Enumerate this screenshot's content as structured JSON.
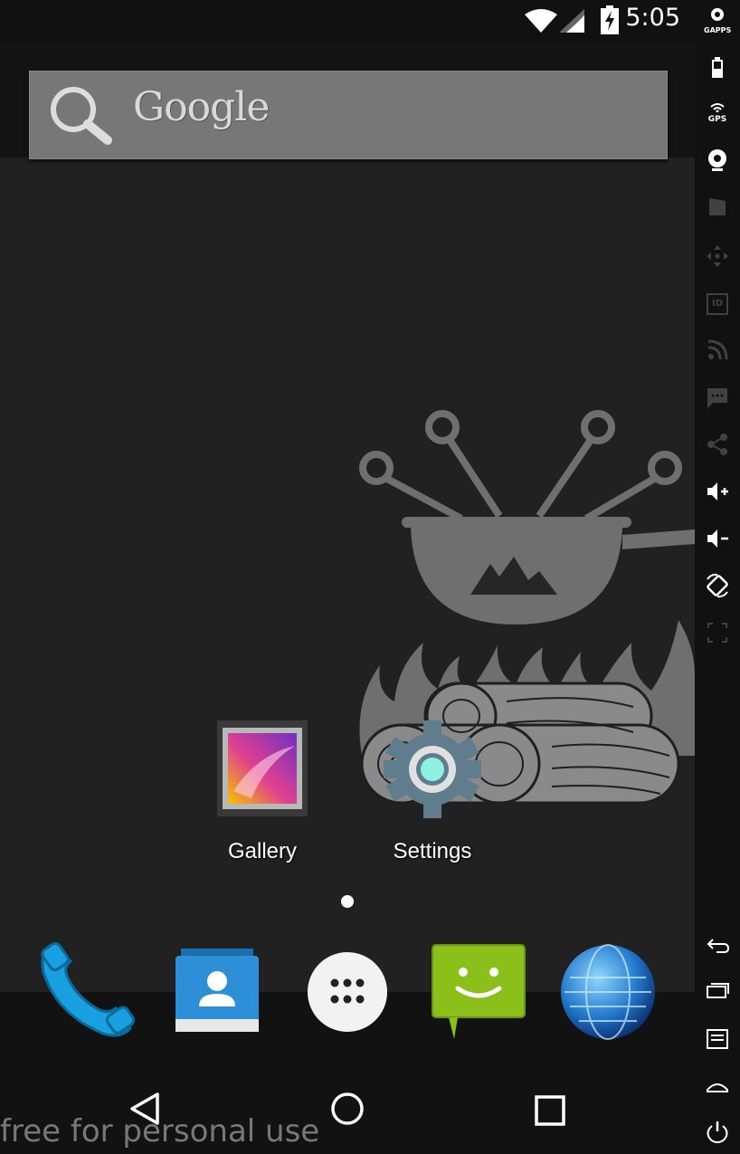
{
  "status_bar": {
    "time": "5:05"
  },
  "search": {
    "logo_text": "Google"
  },
  "home": {
    "apps": [
      {
        "label": "Gallery"
      },
      {
        "label": "Settings"
      }
    ]
  },
  "dock": {
    "items": [
      "phone-icon",
      "contacts-icon",
      "app-drawer-icon",
      "messaging-icon",
      "browser-icon"
    ]
  },
  "navbar": {
    "items": [
      "back-icon",
      "home-icon",
      "recents-icon"
    ]
  },
  "watermark": "free for personal use",
  "emulator_sidebar": {
    "gapps_label": "GAPPS",
    "gps_label": "GPS",
    "id_label": "ID"
  },
  "colors": {
    "messaging_green": "#8bbf1a",
    "contacts_blue": "#2c8fd8",
    "phone_blue": "#1aa0e0"
  }
}
